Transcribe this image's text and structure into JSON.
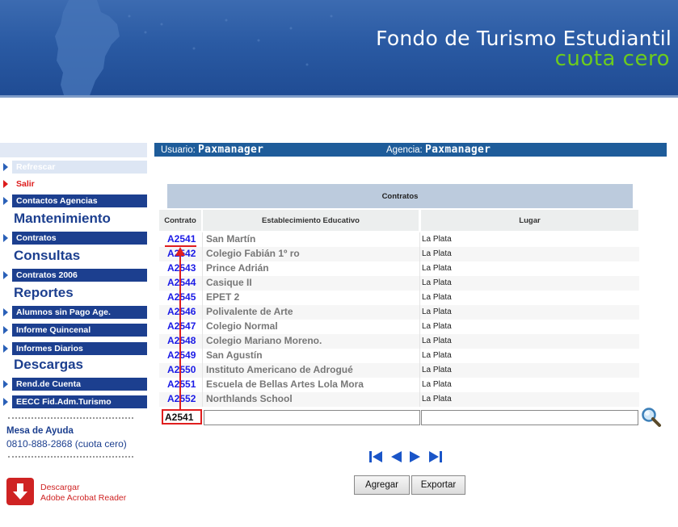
{
  "banner": {
    "title": "Fondo de Turismo Estudiantil",
    "subtitle": "cuota cero",
    "colors": {
      "background": "#2a5aa3",
      "subtitle": "#6dcc1d"
    }
  },
  "user_bar": {
    "user_label": "Usuario:",
    "user_value": "Paxmanager",
    "agency_label": "Agencia:",
    "agency_value": "Paxmanager"
  },
  "sidebar": {
    "refresh": "Refrescar",
    "logout": "Salir",
    "contacts": "Contactos Agencias",
    "sections": [
      {
        "title": "Mantenimiento",
        "items": [
          "Contratos"
        ]
      },
      {
        "title": "Consultas",
        "items": [
          "Contratos 2006"
        ]
      },
      {
        "title": "Reportes",
        "items": [
          "Alumnos sin Pago Age.",
          "Informe Quincenal",
          "Informes Diarios"
        ]
      },
      {
        "title": "Descargas",
        "items": [
          "Rend.de Cuenta",
          "EECC Fid.Adm.Turismo"
        ]
      }
    ],
    "help_title": "Mesa de Ayuda",
    "help_phone": "0810-888-2868 (cuota cero)",
    "acrobat_line1": "Descargar",
    "acrobat_line2": "Adobe Acrobat Reader"
  },
  "table": {
    "caption": "Contratos",
    "headers": [
      "Contrato",
      "Establecimiento Educativo",
      "Lugar"
    ],
    "rows": [
      {
        "contrato": "A2541",
        "establecimiento": "San Martín",
        "lugar": "La Plata"
      },
      {
        "contrato": "A2542",
        "establecimiento": "Colegio Fabián 1º ro",
        "lugar": "La Plata"
      },
      {
        "contrato": "A2543",
        "establecimiento": "Prince Adrián",
        "lugar": "La Plata"
      },
      {
        "contrato": "A2544",
        "establecimiento": "Casique II",
        "lugar": "La Plata"
      },
      {
        "contrato": "A2545",
        "establecimiento": "EPET 2",
        "lugar": "La Plata"
      },
      {
        "contrato": "A2546",
        "establecimiento": "Polivalente de Arte",
        "lugar": "La Plata"
      },
      {
        "contrato": "A2547",
        "establecimiento": "Colegio Normal",
        "lugar": "La Plata"
      },
      {
        "contrato": "A2548",
        "establecimiento": "Colegio Mariano Moreno.",
        "lugar": "La Plata"
      },
      {
        "contrato": "A2549",
        "establecimiento": "San Agustín",
        "lugar": "La Plata"
      },
      {
        "contrato": "A2550",
        "establecimiento": "Instituto Americano de Adrogué",
        "lugar": "La Plata"
      },
      {
        "contrato": "A2551",
        "establecimiento": "Escuela de Bellas Artes Lola Mora",
        "lugar": "La Plata"
      },
      {
        "contrato": "A2552",
        "establecimiento": "Northlands School",
        "lugar": "La Plata"
      }
    ],
    "filter": {
      "contrato": "A2541",
      "establecimiento": "",
      "lugar": ""
    }
  },
  "pager_icons": [
    "first-page-icon",
    "prev-page-icon",
    "next-page-icon",
    "last-page-icon"
  ],
  "buttons": {
    "add": "Agregar",
    "export": "Exportar"
  }
}
